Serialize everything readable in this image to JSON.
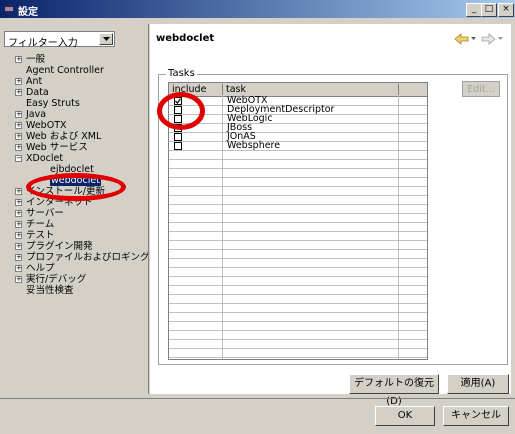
{
  "window": {
    "title": "設定",
    "min_label": "_",
    "max_label": "□",
    "close_label": "×"
  },
  "filter": {
    "value": "フィルター入力"
  },
  "tree": {
    "items": [
      {
        "label": "一般",
        "expander": "+"
      },
      {
        "label": "Agent Controller",
        "expander": ""
      },
      {
        "label": "Ant",
        "expander": "+"
      },
      {
        "label": "Data",
        "expander": "+"
      },
      {
        "label": "Easy Struts",
        "expander": ""
      },
      {
        "label": "Java",
        "expander": "+"
      },
      {
        "label": "WebOTX",
        "expander": "+"
      },
      {
        "label": "Web および XML",
        "expander": "+"
      },
      {
        "label": "Web サービス",
        "expander": "+"
      },
      {
        "label": "XDoclet",
        "expander": "−"
      },
      {
        "label": "ejbdoclet",
        "expander": "",
        "child": true
      },
      {
        "label": "webdoclet",
        "expander": "",
        "child": true,
        "selected": true
      },
      {
        "label": "インストール/更新",
        "expander": "+"
      },
      {
        "label": "インターネット",
        "expander": "+"
      },
      {
        "label": "サーバー",
        "expander": "+"
      },
      {
        "label": "チーム",
        "expander": "+"
      },
      {
        "label": "テスト",
        "expander": "+"
      },
      {
        "label": "プラグイン開発",
        "expander": "+"
      },
      {
        "label": "プロファイルおよびロギング",
        "expander": "+"
      },
      {
        "label": "ヘルプ",
        "expander": "+"
      },
      {
        "label": "実行/デバッグ",
        "expander": "+"
      },
      {
        "label": "妥当性検査",
        "expander": ""
      }
    ]
  },
  "page": {
    "title": "webdoclet"
  },
  "tasks": {
    "group_label": "Tasks",
    "col_include": "include",
    "col_task": "task",
    "rows": [
      {
        "task": "WebOTX",
        "checked": true
      },
      {
        "task": "DeploymentDescriptor",
        "checked": false
      },
      {
        "task": "WebLogic",
        "checked": false
      },
      {
        "task": "JBoss",
        "checked": false
      },
      {
        "task": "JOnAS",
        "checked": false
      },
      {
        "task": "Websphere",
        "checked": false
      }
    ],
    "edit_label": "Edit..."
  },
  "buttons": {
    "restore_defaults": "デフォルトの復元(D)",
    "apply": "適用(A)",
    "ok": "OK",
    "cancel": "キャンセル"
  },
  "colors": {
    "highlight_ring": "#e00000",
    "selection": "#0a246a"
  },
  "icons": {
    "back": "arrow-left-icon",
    "forward": "arrow-right-icon",
    "dropdown": "chevron-down-icon"
  }
}
